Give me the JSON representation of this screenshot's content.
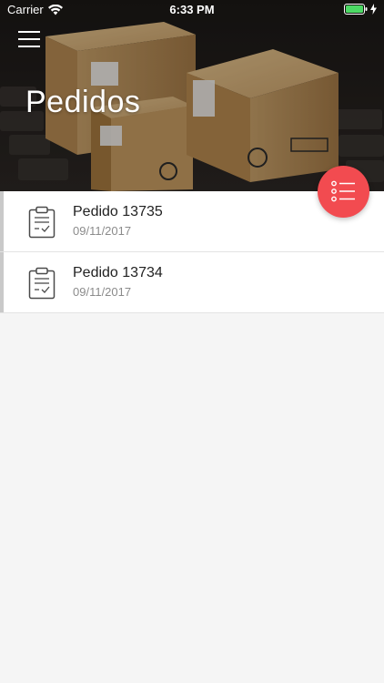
{
  "status_bar": {
    "carrier": "Carrier",
    "time": "6:33 PM"
  },
  "header": {
    "title": "Pedidos"
  },
  "orders": [
    {
      "title": "Pedido 13735",
      "date": "09/11/2017"
    },
    {
      "title": "Pedido 13734",
      "date": "09/11/2017"
    }
  ],
  "colors": {
    "fab": "#f24b50",
    "battery": "#4cd964"
  }
}
